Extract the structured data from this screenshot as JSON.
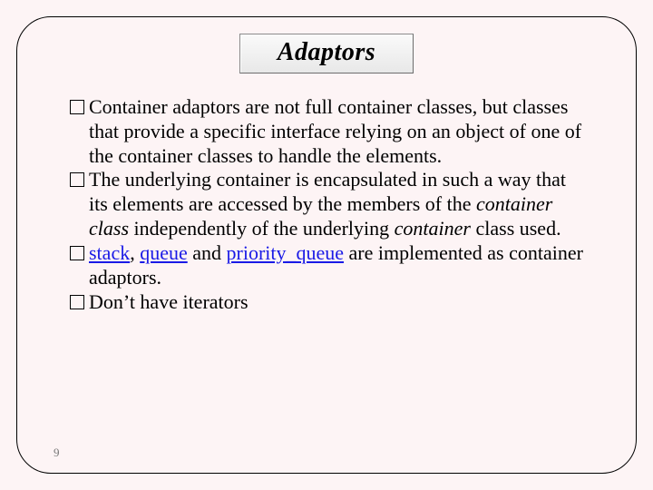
{
  "title": "Adaptors",
  "bullets": {
    "b1": "Container adaptors are not full container classes, but classes that provide a specific interface relying on an object of one of the container classes to handle the elements.",
    "b2_pre": "The underlying container is encapsulated in such a way that its elements are accessed by the members of the ",
    "b2_em1": "container class",
    "b2_mid": " independently of the underlying ",
    "b2_em2": "container",
    "b2_post": " class used.",
    "b3_link1": "stack",
    "b3_sep1": ", ",
    "b3_link2": "queue",
    "b3_sep2": " and ",
    "b3_link3": "priority_queue",
    "b3_post": " are implemented as container adaptors.",
    "b4": "Don’t have iterators"
  },
  "page_number": "9"
}
